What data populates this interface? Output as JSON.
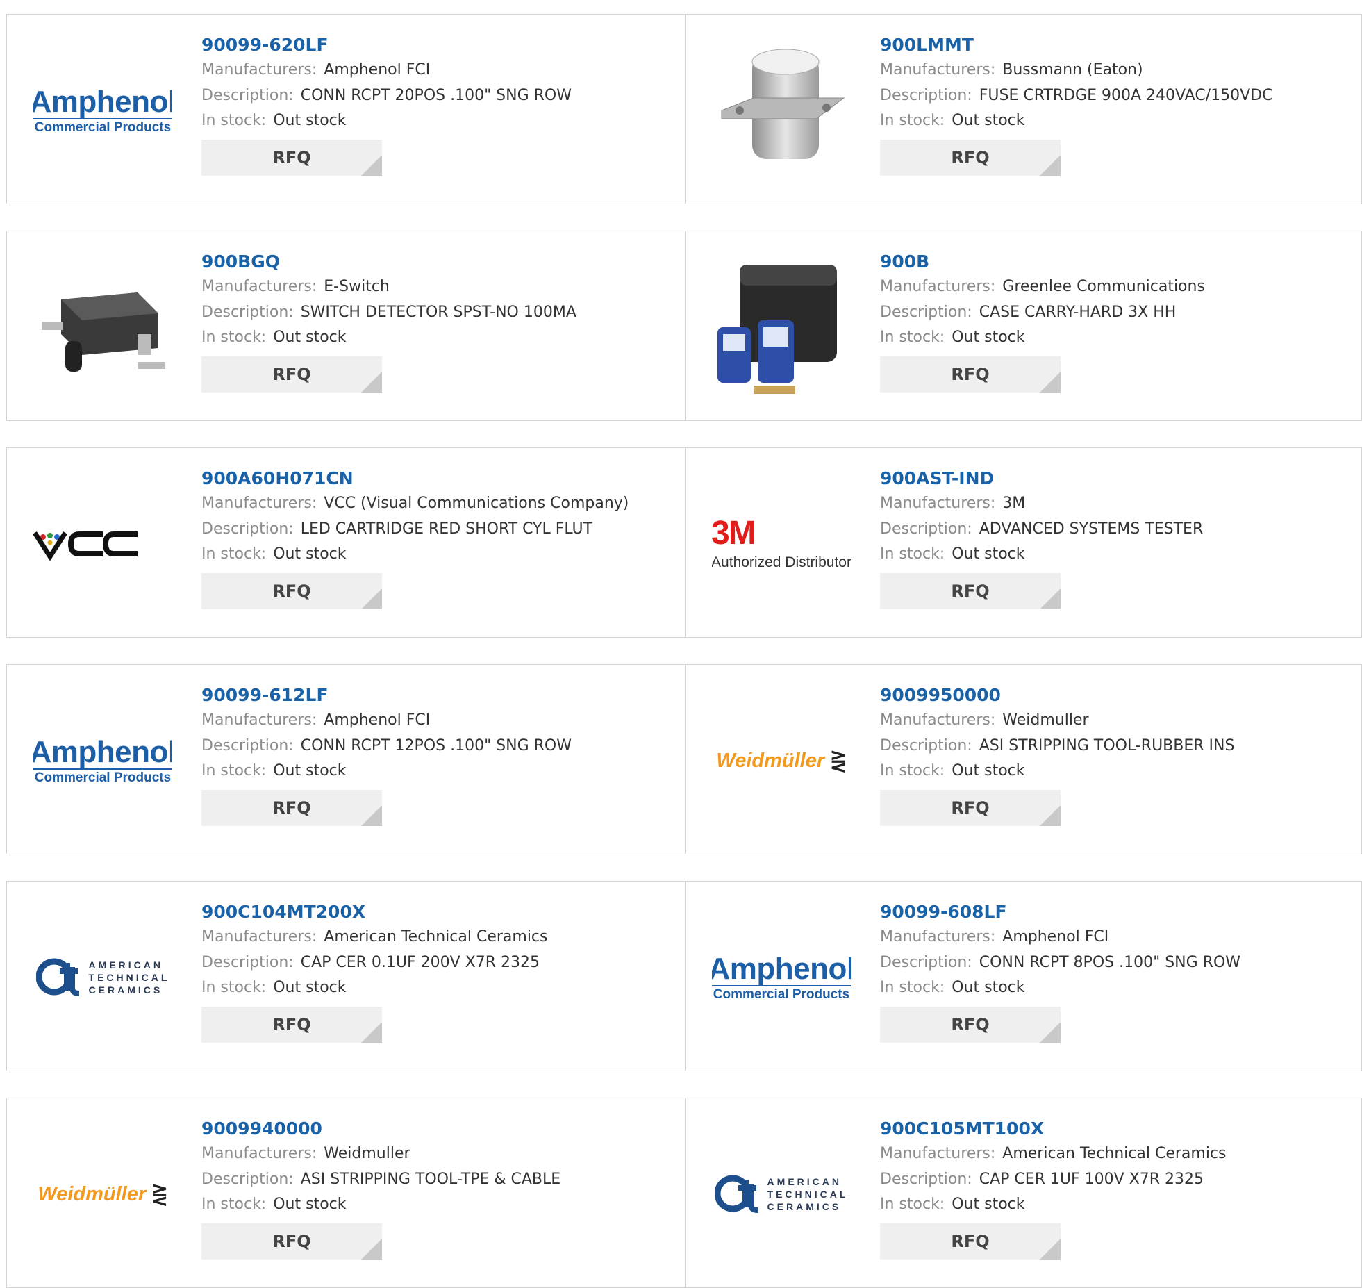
{
  "labels": {
    "manufacturers": "Manufacturers:",
    "description": "Description:",
    "in_stock": "In stock:",
    "rfq": "RFQ"
  },
  "colors": {
    "part_link": "#1a62a8",
    "label_gray": "#8b8b8b",
    "rfq_bg": "#efefef"
  },
  "logos": {
    "amphenol": {
      "line1": "Amphenol",
      "line2": "Commercial Products"
    },
    "vcc": {
      "text": "VCC"
    },
    "m3": {
      "line1": "3M",
      "line2": "Authorized Distributor"
    },
    "weidmuller": {
      "text": "Weidmüller"
    },
    "atc": {
      "line1": "AMERICAN",
      "line2": "TECHNICAL",
      "line3": "CERAMICS"
    }
  },
  "products": [
    {
      "part": "90099-620LF",
      "manufacturer": "Amphenol FCI",
      "description": "CONN RCPT 20POS .100\" SNG ROW",
      "stock": "Out stock",
      "image": "amphenol"
    },
    {
      "part": "900LMMT",
      "manufacturer": "Bussmann (Eaton)",
      "description": "FUSE CRTRDGE 900A 240VAC/150VDC",
      "stock": "Out stock",
      "image": "fuse-photo"
    },
    {
      "part": "900BGQ",
      "manufacturer": "E-Switch",
      "description": "SWITCH DETECTOR SPST-NO 100MA",
      "stock": "Out stock",
      "image": "switch-photo"
    },
    {
      "part": "900B",
      "manufacturer": "Greenlee Communications",
      "description": "CASE CARRY-HARD 3X HH",
      "stock": "Out stock",
      "image": "case-photo"
    },
    {
      "part": "900A60H071CN",
      "manufacturer": "VCC (Visual Communications Company)",
      "description": "LED CARTRIDGE RED SHORT CYL FLUT",
      "stock": "Out stock",
      "image": "vcc"
    },
    {
      "part": "900AST-IND",
      "manufacturer": "3M",
      "description": "ADVANCED SYSTEMS TESTER",
      "stock": "Out stock",
      "image": "m3"
    },
    {
      "part": "90099-612LF",
      "manufacturer": "Amphenol FCI",
      "description": "CONN RCPT 12POS .100\" SNG ROW",
      "stock": "Out stock",
      "image": "amphenol"
    },
    {
      "part": "9009950000",
      "manufacturer": "Weidmuller",
      "description": "ASI STRIPPING TOOL-RUBBER INS",
      "stock": "Out stock",
      "image": "weidmuller"
    },
    {
      "part": "900C104MT200X",
      "manufacturer": "American Technical Ceramics",
      "description": "CAP CER 0.1UF 200V X7R 2325",
      "stock": "Out stock",
      "image": "atc"
    },
    {
      "part": "90099-608LF",
      "manufacturer": "Amphenol FCI",
      "description": "CONN RCPT 8POS .100\" SNG ROW",
      "stock": "Out stock",
      "image": "amphenol"
    },
    {
      "part": "9009940000",
      "manufacturer": "Weidmuller",
      "description": "ASI STRIPPING TOOL-TPE & CABLE",
      "stock": "Out stock",
      "image": "weidmuller"
    },
    {
      "part": "900C105MT100X",
      "manufacturer": "American Technical Ceramics",
      "description": "CAP CER 1UF 100V X7R 2325",
      "stock": "Out stock",
      "image": "atc"
    }
  ]
}
